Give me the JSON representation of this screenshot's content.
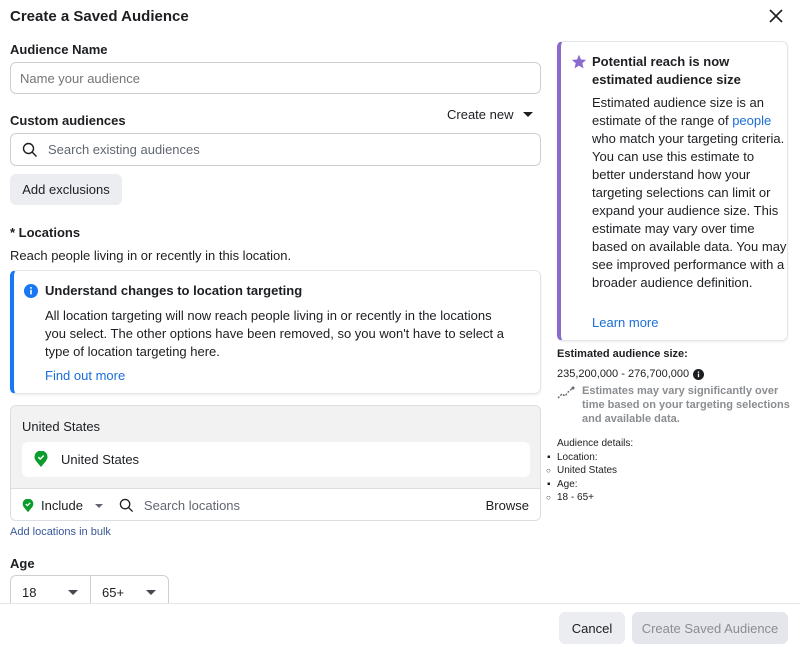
{
  "dialog": {
    "title": "Create a Saved Audience",
    "close_icon": "close-icon"
  },
  "audience_name": {
    "label": "Audience Name",
    "placeholder": "Name your audience",
    "value": ""
  },
  "custom_audiences": {
    "label": "Custom audiences",
    "create_new": "Create new",
    "search_placeholder": "Search existing audiences",
    "add_exclusions": "Add exclusions"
  },
  "locations": {
    "label": "* Locations",
    "description": "Reach people living in or recently in this location.",
    "notice": {
      "icon": "info-icon",
      "title": "Understand changes to location targeting",
      "body": "All location targeting will now reach people living in or recently in the locations you select. The other options have been removed, so you won't have to select a type of location targeting here.",
      "link": "Find out more"
    },
    "group_header": "United States",
    "selected": [
      "United States"
    ],
    "include_label": "Include",
    "search_placeholder": "Search locations",
    "browse": "Browse",
    "add_bulk": "Add locations in bulk"
  },
  "age": {
    "label": "Age",
    "min": "18",
    "max": "65+"
  },
  "sidebar": {
    "card": {
      "icon": "star-icon",
      "title": "Potential reach is now estimated audience size",
      "body_before": "Estimated audience size is an estimate of the range of ",
      "body_link": "people",
      "body_after": " who match your targeting criteria. You can use this estimate to better understand how your targeting selections can limit or expand your audience size. This estimate may vary over time based on available data. You may see improved performance with a broader audience definition.",
      "learn_more": "Learn more"
    },
    "estimate_label": "Estimated audience size:",
    "estimate_value": "235,200,000 - 276,700,000",
    "estimate_note": "Estimates may vary significantly over time based on your targeting selections and available data.",
    "details_label": "Audience details:",
    "details": [
      {
        "key": "Location:",
        "value": "United States"
      },
      {
        "key": "Age:",
        "value": "18 - 65+"
      }
    ]
  },
  "footer": {
    "cancel": "Cancel",
    "submit": "Create Saved Audience"
  },
  "colors": {
    "link": "#1a6ed8",
    "info_accent": "#1877f2",
    "reach_accent": "#8a6acf",
    "include_green": "#31a24c"
  }
}
